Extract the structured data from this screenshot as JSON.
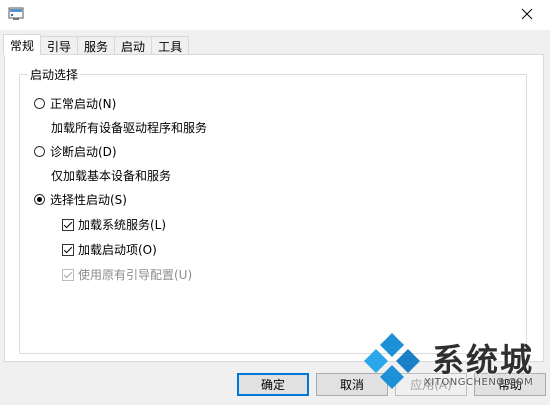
{
  "tabs": [
    {
      "label": "常规",
      "active": true
    },
    {
      "label": "引导"
    },
    {
      "label": "服务"
    },
    {
      "label": "启动"
    },
    {
      "label": "工具"
    }
  ],
  "group": {
    "title": "启动选择",
    "normal": {
      "label": "正常启动(N)",
      "desc": "加载所有设备驱动程序和服务",
      "selected": false
    },
    "diagnostic": {
      "label": "诊断启动(D)",
      "desc": "仅加载基本设备和服务",
      "selected": false
    },
    "selective": {
      "label": "选择性启动(S)",
      "selected": true
    },
    "options": [
      {
        "label": "加载系统服务(L)",
        "checked": true,
        "enabled": true
      },
      {
        "label": "加载启动项(O)",
        "checked": true,
        "enabled": true
      },
      {
        "label": "使用原有引导配置(U)",
        "checked": true,
        "enabled": false
      }
    ]
  },
  "buttons": {
    "ok": "确定",
    "cancel": "取消",
    "apply": "应用(A)",
    "help": "帮助"
  },
  "watermark": {
    "brand": "系统城",
    "url": "XITONGCHENG.COM"
  },
  "colors": {
    "accent": "#0078d7",
    "watermark_blue": "#1e90d8"
  }
}
